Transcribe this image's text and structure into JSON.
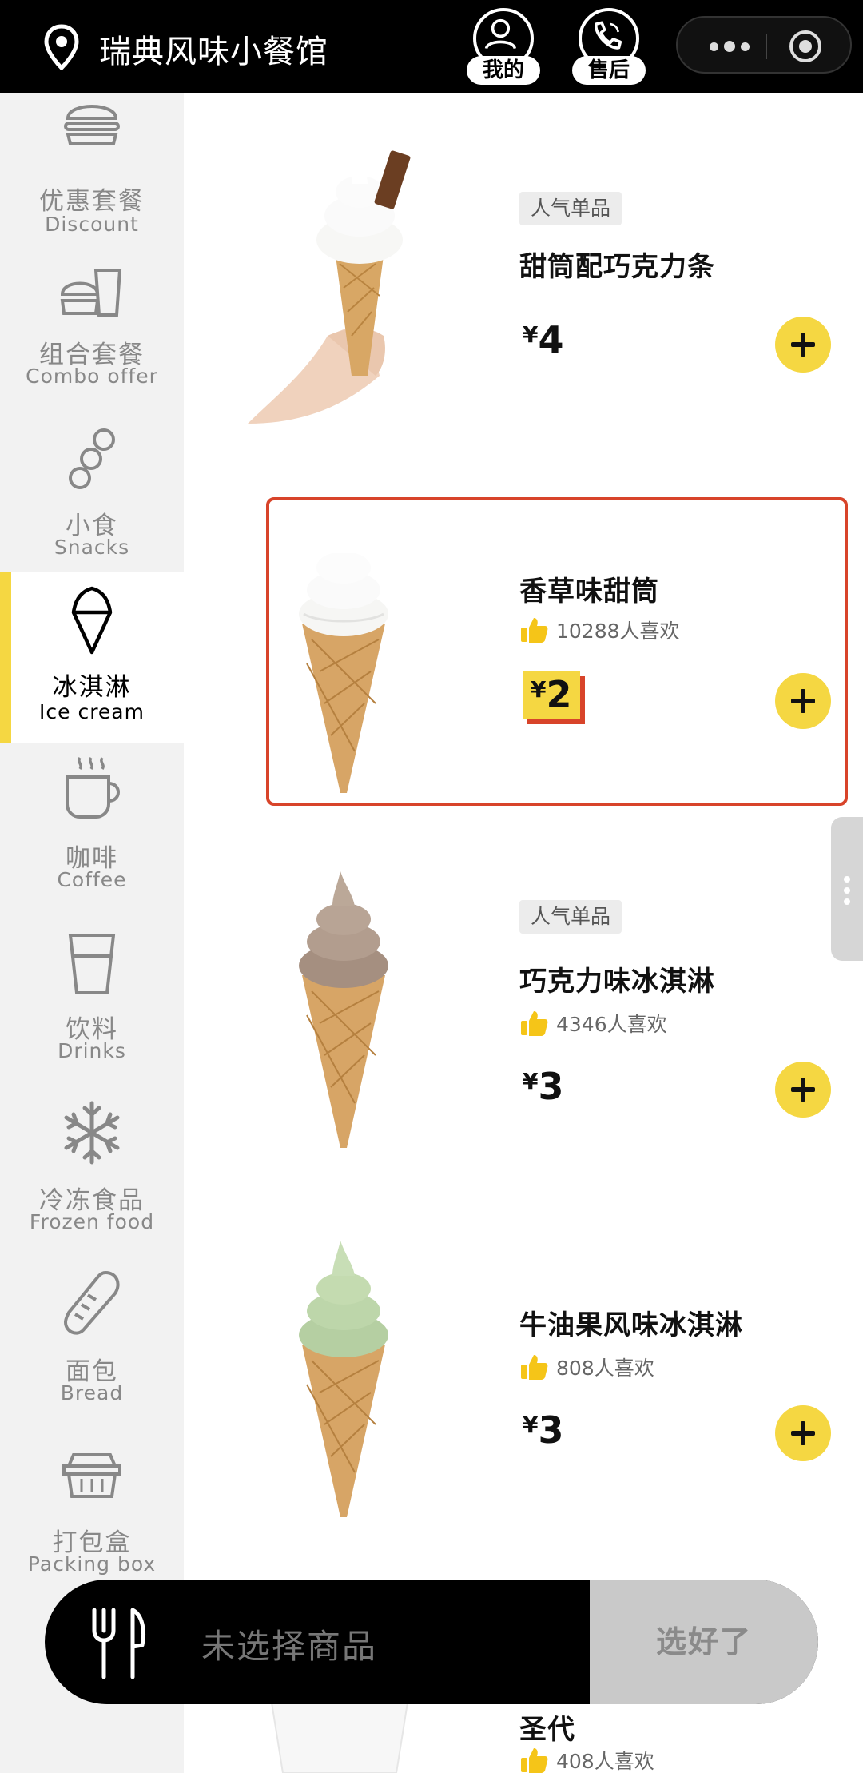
{
  "header": {
    "store_name": "瑞典风味小餐馆",
    "my_label": "我的",
    "service_label": "售后",
    "more_icon": "more-dots-icon",
    "close_icon": "target-icon"
  },
  "sidebar": {
    "items": [
      {
        "cn": "优惠套餐",
        "en": "Discount",
        "icon": "burger-icon"
      },
      {
        "cn": "组合套餐",
        "en": "Combo offer",
        "icon": "combo-meal-icon"
      },
      {
        "cn": "小食",
        "en": "Snacks",
        "icon": "snacks-icon"
      },
      {
        "cn": "冰淇淋",
        "en": "Ice cream",
        "icon": "ice-cream-icon"
      },
      {
        "cn": "咖啡",
        "en": "Coffee",
        "icon": "coffee-cup-icon"
      },
      {
        "cn": "饮料",
        "en": "Drinks",
        "icon": "drink-glass-icon"
      },
      {
        "cn": "冷冻食品",
        "en": "Frozen food",
        "icon": "snowflake-icon"
      },
      {
        "cn": "面包",
        "en": "Bread",
        "icon": "bread-icon"
      },
      {
        "cn": "打包盒",
        "en": "Packing box",
        "icon": "packing-box-icon"
      }
    ],
    "active": "冰淇淋"
  },
  "products": [
    {
      "tag": "人气单品",
      "name": "甜筒配巧克力条",
      "likes": "",
      "currency": "¥",
      "price": "4"
    },
    {
      "tag": "",
      "name": "香草味甜筒",
      "likes": "10288人喜欢",
      "currency": "¥",
      "price": "2"
    },
    {
      "tag": "人气单品",
      "name": "巧克力味冰淇淋",
      "likes": "4346人喜欢",
      "currency": "¥",
      "price": "3"
    },
    {
      "tag": "",
      "name": "牛油果风味冰淇淋",
      "likes": "808人喜欢",
      "currency": "¥",
      "price": "3"
    },
    {
      "tag": "",
      "name": "圣代",
      "likes": "408人喜欢",
      "currency": "",
      "price": ""
    }
  ],
  "cart": {
    "status": "未选择商品",
    "checkout_label": "选好了"
  },
  "colors": {
    "accent": "#f5d742",
    "highlight_border": "#d8442a",
    "header_bg": "#000000",
    "sidebar_bg": "#f2f2f2"
  }
}
